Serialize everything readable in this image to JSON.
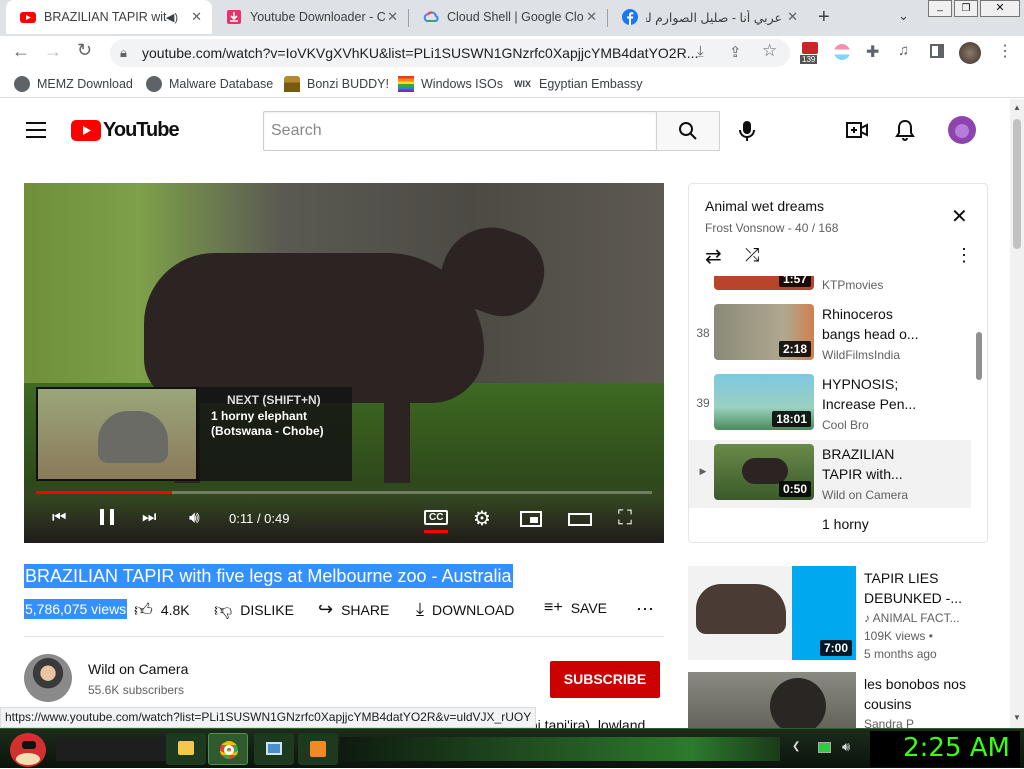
{
  "browser": {
    "tabs": [
      {
        "title": "BRAZILIAN TAPIR wit",
        "active": true
      },
      {
        "title": "Youtube Downloader - Co",
        "active": false
      },
      {
        "title": "Cloud Shell | Google Clo",
        "active": false
      },
      {
        "title": "عربي أنا - صليل الصوارم لعبة",
        "active": false
      }
    ],
    "url": "youtube.com/watch?v=IoVKVgXVhKU&list=PLi1SUSWN1GNzrfc0XapjjcYMB4datYO2R...",
    "extension_badge": "139",
    "bookmarks": [
      "MEMZ Download",
      "Malware Database",
      "Bonzi BUDDY!",
      "Windows ISOs",
      "Egyptian Embassy"
    ]
  },
  "youtube": {
    "logo_text": "YouTube",
    "search_placeholder": "Search",
    "player": {
      "next_label": "NEXT (SHIFT+N)",
      "next_title": "1 horny elephant (Botswana - Chobe)",
      "time": "0:11 / 0:49",
      "progress_fraction": 0.22,
      "cc_label": "CC"
    },
    "video": {
      "title": "BRAZILIAN TAPIR with five legs at Melbourne zoo - Australia",
      "views": "5,786,075 views",
      "likes": "4.8K",
      "dislike": "DISLIKE",
      "share": "SHARE",
      "download": "DOWNLOAD",
      "save": "SAVE",
      "channel": "Wild on Camera",
      "subscribers": "55.6K subscribers",
      "subscribe": "SUBSCRIBE",
      "desc_fragment": "upi tapi'ira), lowland"
    },
    "playlist": {
      "title": "Animal wet dreams",
      "subtitle": "Frost Vonsnow - 40 / 168",
      "items": [
        {
          "num": "",
          "title": "",
          "channel": "KTPmovies",
          "duration": "1:57"
        },
        {
          "num": "38",
          "title": "Rhinoceros bangs head o...",
          "channel": "WildFilmsIndia",
          "duration": "2:18"
        },
        {
          "num": "39",
          "title": "HYPNOSIS; Increase Pen...",
          "channel": "Cool Bro",
          "duration": "18:01"
        },
        {
          "num": "▶",
          "title": "BRAZILIAN TAPIR with...",
          "channel": "Wild on Camera",
          "duration": "0:50"
        },
        {
          "num": "",
          "title": "1 horny",
          "channel": "",
          "duration": ""
        }
      ]
    },
    "recommendations": [
      {
        "title": "TAPIR LIES DEBUNKED -...",
        "channel": "ANIMAL FACT...",
        "views": "109K views •",
        "age": "5 months ago",
        "duration": "7:00"
      },
      {
        "title": "les bonobos nos cousins",
        "channel": "Sandra P",
        "views": "",
        "age": "",
        "duration": ""
      }
    ]
  },
  "status_url": "https://www.youtube.com/watch?list=PLi1SUSWN1GNzrfc0XapjjcYMB4datYO2R&v=uldVJX_rUOY",
  "taskbar": {
    "clock": "2:25 AM"
  },
  "colors": {
    "youtube_red": "#ff0000",
    "subscribe_red": "#cc0000",
    "selection": "#3390ff",
    "clock_green": "#39ff14"
  }
}
